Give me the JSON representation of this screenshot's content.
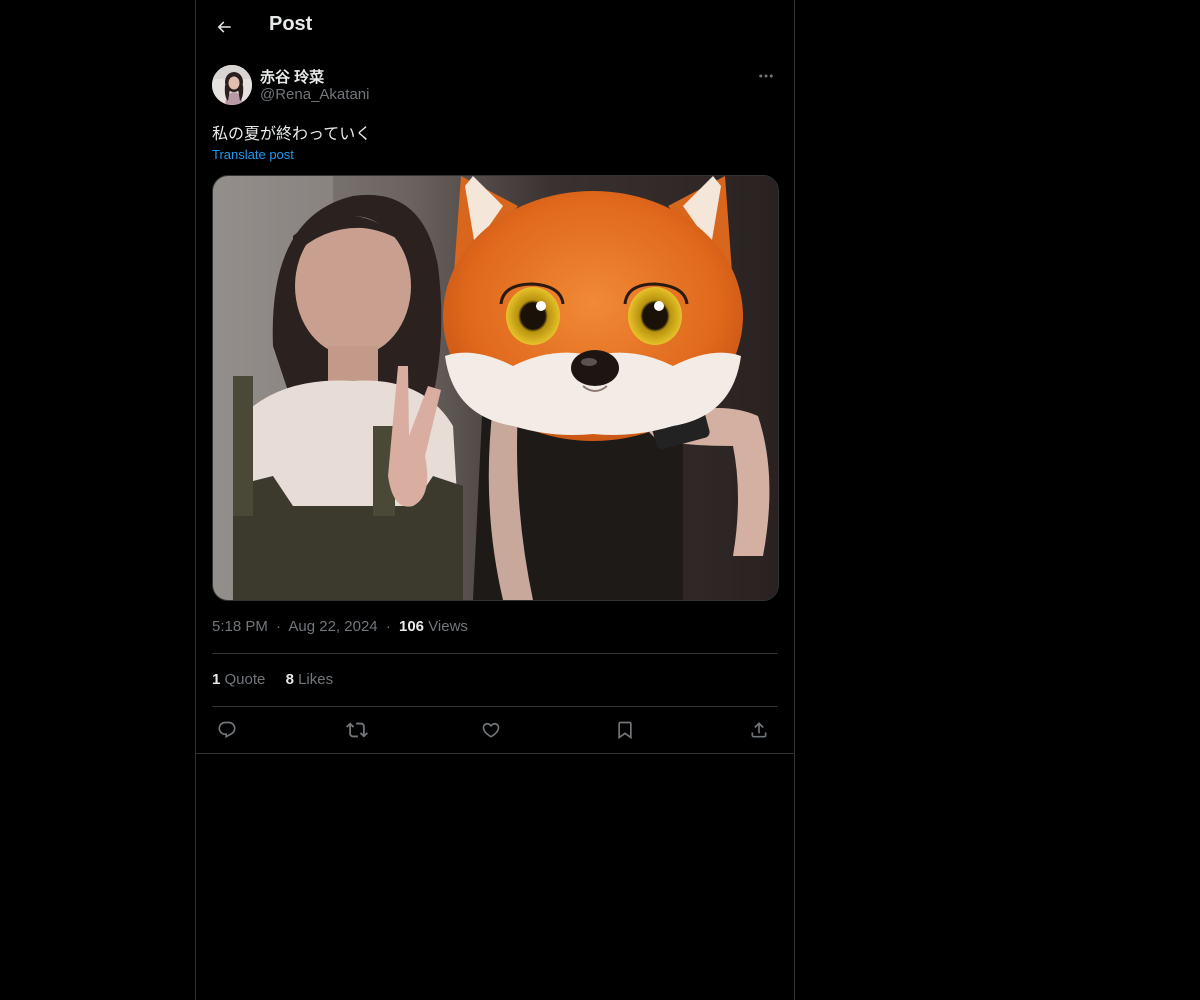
{
  "header": {
    "title": "Post"
  },
  "post": {
    "author": {
      "display_name": "赤谷 玲菜",
      "handle": "@Rena_Akatani"
    },
    "text": "私の夏が終わっていく",
    "translate_label": "Translate post",
    "time": "5:18 PM",
    "date": "Aug 22, 2024",
    "separator": "·",
    "views_count": "106",
    "views_label": "Views",
    "stats": {
      "quotes_count": "1",
      "quotes_label": "Quote",
      "likes_count": "8",
      "likes_label": "Likes"
    }
  },
  "icons": {
    "back": "arrow-left-icon",
    "more": "more-horizontal-icon",
    "reply": "reply-icon",
    "repost": "repost-icon",
    "like": "heart-icon",
    "bookmark": "bookmark-icon",
    "share": "share-icon"
  },
  "colors": {
    "background": "#000000",
    "text_primary": "#e7e9ea",
    "text_secondary": "#71767b",
    "link": "#1d9bf0",
    "border": "#2f3336"
  }
}
